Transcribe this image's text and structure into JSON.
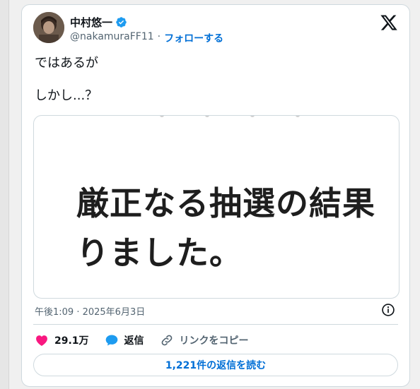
{
  "author": {
    "display_name": "中村悠一",
    "handle": "@nakamuraFF11",
    "separator": "·",
    "follow_label": "フォローする",
    "verified": true
  },
  "tweet": {
    "lines": [
      "ではあるが",
      "しかし...？"
    ]
  },
  "media": {
    "text_line1": "厳正なる抽選の結果",
    "text_line2": "りました。"
  },
  "meta": {
    "timestamp": "午後1:09 · 2025年6月3日"
  },
  "actions": {
    "likes": "29.1万",
    "reply_label": "返信",
    "copy_link_label": "リンクをコピー"
  },
  "read_replies_label": "1,221件の返信を読む",
  "colors": {
    "accent": "#006fd6",
    "like": "#f91880",
    "reply": "#1d9bf0",
    "text": "#0f1419",
    "secondary": "#536471"
  },
  "icons": {
    "verified": "verified-badge-icon",
    "brand": "x-logo-icon",
    "info": "info-icon",
    "like": "heart-icon",
    "reply": "speech-bubble-icon",
    "copy": "link-icon"
  }
}
